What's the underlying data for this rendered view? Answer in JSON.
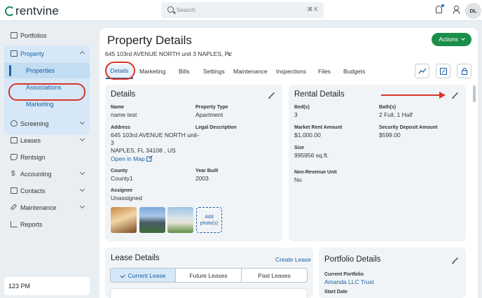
{
  "app": {
    "logo_text": "rentvine"
  },
  "search": {
    "placeholder": "Search",
    "shortcut": "⌘ K"
  },
  "user": {
    "initials": "DL"
  },
  "sidebar": {
    "items": [
      {
        "label": "Portfolios",
        "icon": "folder-icon"
      },
      {
        "label": "Property",
        "icon": "building-icon",
        "expanded": true
      },
      {
        "label": "Screening",
        "icon": "screening-icon"
      },
      {
        "label": "Leases",
        "icon": "leases-icon"
      },
      {
        "label": "Rentsign",
        "icon": "rentsign-icon"
      },
      {
        "label": "Accounting",
        "icon": "dollar-icon"
      },
      {
        "label": "Contacts",
        "icon": "contacts-icon"
      },
      {
        "label": "Maintenance",
        "icon": "wrench-icon"
      },
      {
        "label": "Reports",
        "icon": "chart-icon"
      }
    ],
    "property_sub": [
      "Properties",
      "Associations",
      "Marketing"
    ],
    "time": "123 PM"
  },
  "page": {
    "title": "Property Details",
    "address": "645 103rd AVENUE NORTH unit 3 NAPLES, FL",
    "actions_label": "Actions",
    "tabs": [
      "Details",
      "Marketing",
      "Bills",
      "Settings",
      "Maintenance",
      "Inspections",
      "Files",
      "Budgets"
    ]
  },
  "details": {
    "title": "Details",
    "name_label": "Name",
    "name_value": "name test",
    "type_label": "Property Type",
    "type_value": "Apartment",
    "address_label": "Address",
    "address_line1": "645 103rd AVENUE NORTH unit",
    "address_line2": "3",
    "address_line3": "NAPLES, FL 34108 , US",
    "open_map": "Open in Map",
    "legal_label": "Legal Description",
    "legal_value": "--",
    "county_label": "County",
    "county_value": "County1",
    "year_label": "Year Built",
    "year_value": "2003",
    "assignee_label": "Assignee",
    "assignee_value": "Unassigned",
    "add_photo_1": "Add",
    "add_photo_2": "photo(s)"
  },
  "rental": {
    "title": "Rental Details",
    "beds_label": "Bed(s)",
    "beds_value": "3",
    "baths_label": "Bath(s)",
    "baths_value": "2 Full, 1 Half",
    "market_label": "Market Rent Amount",
    "market_value": "$1,000.00",
    "deposit_label": "Security Deposit Amount",
    "deposit_value": "$599.00",
    "size_label": "Size",
    "size_value": "995956 sq.ft.",
    "nonrev_label": "Non-Revenue Unit",
    "nonrev_value": "No"
  },
  "lease": {
    "title": "Lease Details",
    "create": "Create Lease",
    "segments": [
      "Current Lease",
      "Future Leases",
      "Past Leases"
    ]
  },
  "portfolio": {
    "title": "Portfolio Details",
    "current_label": "Current Portfolio",
    "current_value": "Amanda LLC Trust",
    "start_label": "Start Date"
  },
  "colors": {
    "accent": "#1d5fa5",
    "action": "#1b8f4a",
    "annotation": "#d9342b"
  }
}
